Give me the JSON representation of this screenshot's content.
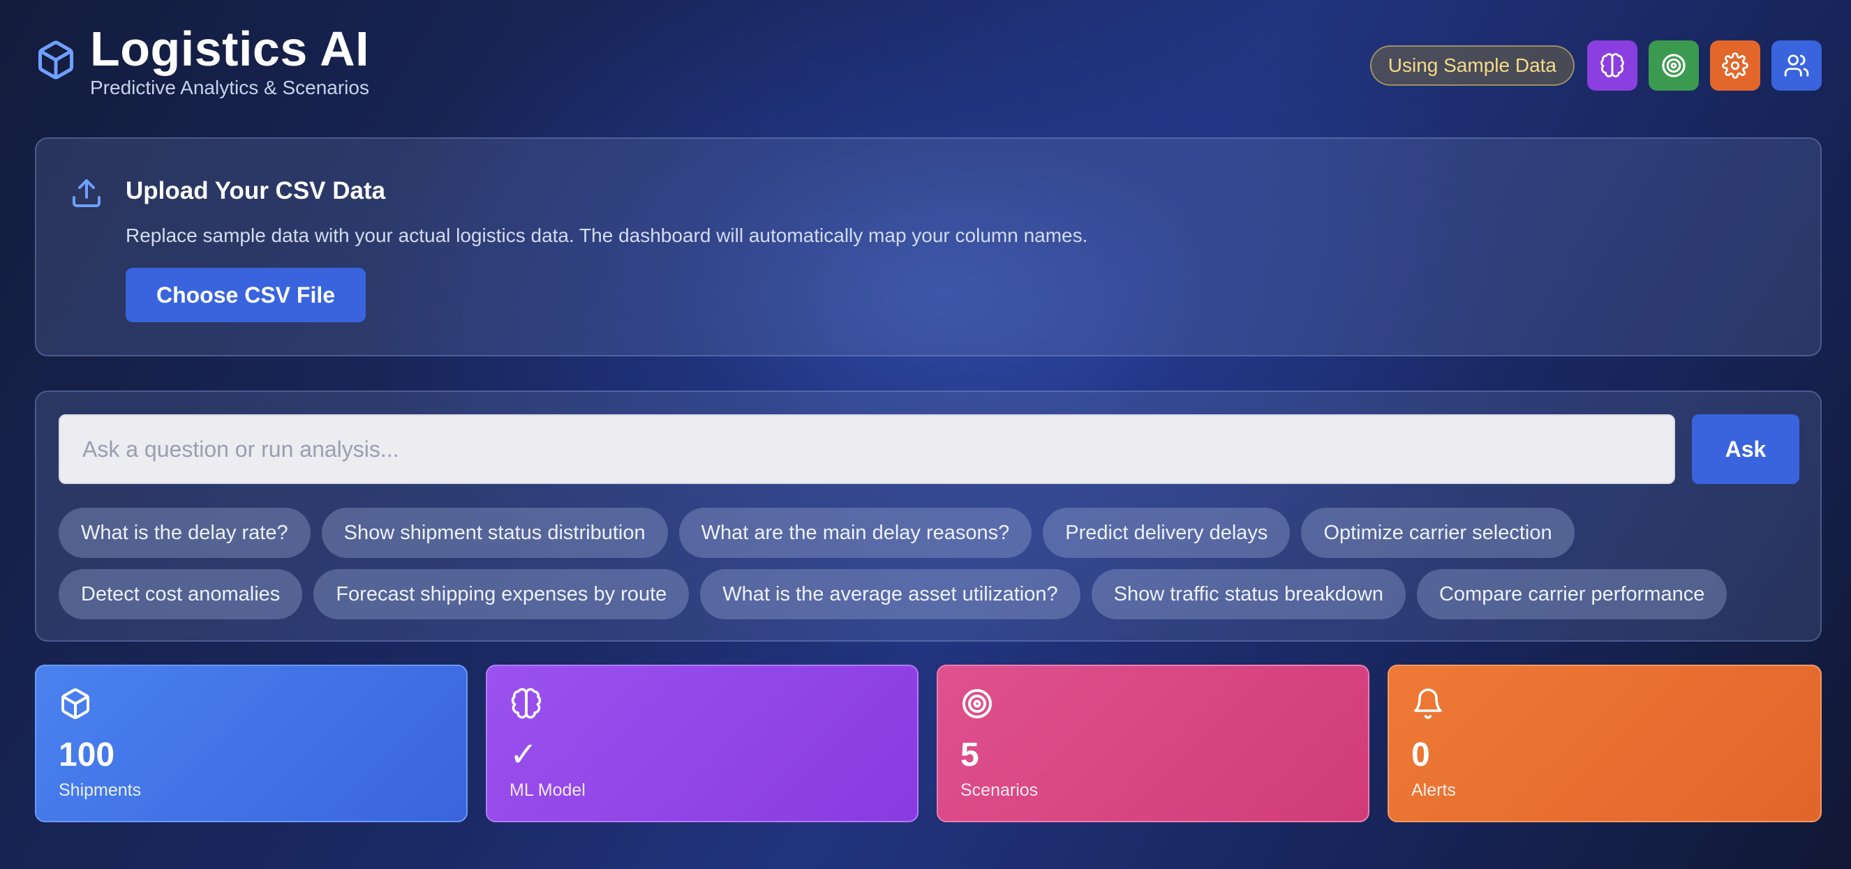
{
  "header": {
    "title": "Logistics AI",
    "subtitle": "Predictive Analytics & Scenarios",
    "brand_icon": "package-icon",
    "sample_badge": "Using Sample Data",
    "actions": [
      {
        "name": "brain-icon",
        "color": "#8b3fe0"
      },
      {
        "name": "target-icon",
        "color": "#3b9a4f"
      },
      {
        "name": "gear-icon",
        "color": "#e3672b"
      },
      {
        "name": "users-icon",
        "color": "#3a64dd"
      }
    ]
  },
  "upload": {
    "icon": "upload-icon",
    "title": "Upload Your CSV Data",
    "description": "Replace sample data with your actual logistics data. The dashboard will automatically map your column names.",
    "button_label": "Choose CSV File"
  },
  "query": {
    "placeholder": "Ask a question or run analysis...",
    "ask_label": "Ask",
    "suggestions_row1": [
      "What is the delay rate?",
      "Show shipment status distribution",
      "What are the main delay reasons?",
      "Predict delivery delays",
      "Optimize carrier selection"
    ],
    "suggestions_row2": [
      "Detect cost anomalies",
      "Forecast shipping expenses by route",
      "What is the average asset utilization?",
      "Show traffic status breakdown",
      "Compare carrier performance"
    ]
  },
  "stats": [
    {
      "icon": "package-icon",
      "value": "100",
      "label": "Shipments",
      "color": "#3a64dd"
    },
    {
      "icon": "brain-icon",
      "value": "✓",
      "label": "ML Model",
      "color": "#8a3ae2"
    },
    {
      "icon": "target-icon",
      "value": "5",
      "label": "Scenarios",
      "color": "#d13c78"
    },
    {
      "icon": "bell-icon",
      "value": "0",
      "label": "Alerts",
      "color": "#e2652b"
    }
  ],
  "colors": {
    "accent": "#3a64dd",
    "badge_text": "#f6dc87"
  }
}
